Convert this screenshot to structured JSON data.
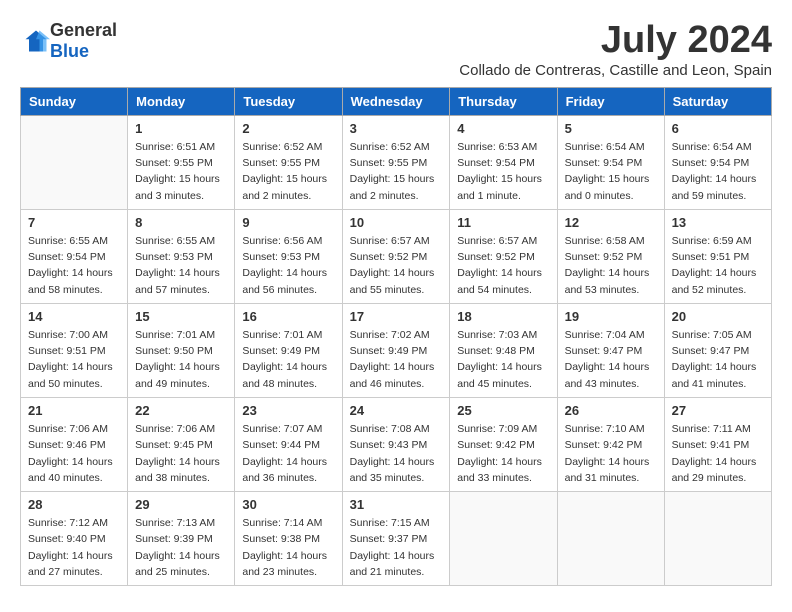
{
  "logo": {
    "general": "General",
    "blue": "Blue"
  },
  "title": {
    "month_year": "July 2024",
    "location": "Collado de Contreras, Castille and Leon, Spain"
  },
  "headers": [
    "Sunday",
    "Monday",
    "Tuesday",
    "Wednesday",
    "Thursday",
    "Friday",
    "Saturday"
  ],
  "weeks": [
    [
      {
        "day": "",
        "info": ""
      },
      {
        "day": "1",
        "info": "Sunrise: 6:51 AM\nSunset: 9:55 PM\nDaylight: 15 hours\nand 3 minutes."
      },
      {
        "day": "2",
        "info": "Sunrise: 6:52 AM\nSunset: 9:55 PM\nDaylight: 15 hours\nand 2 minutes."
      },
      {
        "day": "3",
        "info": "Sunrise: 6:52 AM\nSunset: 9:55 PM\nDaylight: 15 hours\nand 2 minutes."
      },
      {
        "day": "4",
        "info": "Sunrise: 6:53 AM\nSunset: 9:54 PM\nDaylight: 15 hours\nand 1 minute."
      },
      {
        "day": "5",
        "info": "Sunrise: 6:54 AM\nSunset: 9:54 PM\nDaylight: 15 hours\nand 0 minutes."
      },
      {
        "day": "6",
        "info": "Sunrise: 6:54 AM\nSunset: 9:54 PM\nDaylight: 14 hours\nand 59 minutes."
      }
    ],
    [
      {
        "day": "7",
        "info": "Sunrise: 6:55 AM\nSunset: 9:54 PM\nDaylight: 14 hours\nand 58 minutes."
      },
      {
        "day": "8",
        "info": "Sunrise: 6:55 AM\nSunset: 9:53 PM\nDaylight: 14 hours\nand 57 minutes."
      },
      {
        "day": "9",
        "info": "Sunrise: 6:56 AM\nSunset: 9:53 PM\nDaylight: 14 hours\nand 56 minutes."
      },
      {
        "day": "10",
        "info": "Sunrise: 6:57 AM\nSunset: 9:52 PM\nDaylight: 14 hours\nand 55 minutes."
      },
      {
        "day": "11",
        "info": "Sunrise: 6:57 AM\nSunset: 9:52 PM\nDaylight: 14 hours\nand 54 minutes."
      },
      {
        "day": "12",
        "info": "Sunrise: 6:58 AM\nSunset: 9:52 PM\nDaylight: 14 hours\nand 53 minutes."
      },
      {
        "day": "13",
        "info": "Sunrise: 6:59 AM\nSunset: 9:51 PM\nDaylight: 14 hours\nand 52 minutes."
      }
    ],
    [
      {
        "day": "14",
        "info": "Sunrise: 7:00 AM\nSunset: 9:51 PM\nDaylight: 14 hours\nand 50 minutes."
      },
      {
        "day": "15",
        "info": "Sunrise: 7:01 AM\nSunset: 9:50 PM\nDaylight: 14 hours\nand 49 minutes."
      },
      {
        "day": "16",
        "info": "Sunrise: 7:01 AM\nSunset: 9:49 PM\nDaylight: 14 hours\nand 48 minutes."
      },
      {
        "day": "17",
        "info": "Sunrise: 7:02 AM\nSunset: 9:49 PM\nDaylight: 14 hours\nand 46 minutes."
      },
      {
        "day": "18",
        "info": "Sunrise: 7:03 AM\nSunset: 9:48 PM\nDaylight: 14 hours\nand 45 minutes."
      },
      {
        "day": "19",
        "info": "Sunrise: 7:04 AM\nSunset: 9:47 PM\nDaylight: 14 hours\nand 43 minutes."
      },
      {
        "day": "20",
        "info": "Sunrise: 7:05 AM\nSunset: 9:47 PM\nDaylight: 14 hours\nand 41 minutes."
      }
    ],
    [
      {
        "day": "21",
        "info": "Sunrise: 7:06 AM\nSunset: 9:46 PM\nDaylight: 14 hours\nand 40 minutes."
      },
      {
        "day": "22",
        "info": "Sunrise: 7:06 AM\nSunset: 9:45 PM\nDaylight: 14 hours\nand 38 minutes."
      },
      {
        "day": "23",
        "info": "Sunrise: 7:07 AM\nSunset: 9:44 PM\nDaylight: 14 hours\nand 36 minutes."
      },
      {
        "day": "24",
        "info": "Sunrise: 7:08 AM\nSunset: 9:43 PM\nDaylight: 14 hours\nand 35 minutes."
      },
      {
        "day": "25",
        "info": "Sunrise: 7:09 AM\nSunset: 9:42 PM\nDaylight: 14 hours\nand 33 minutes."
      },
      {
        "day": "26",
        "info": "Sunrise: 7:10 AM\nSunset: 9:42 PM\nDaylight: 14 hours\nand 31 minutes."
      },
      {
        "day": "27",
        "info": "Sunrise: 7:11 AM\nSunset: 9:41 PM\nDaylight: 14 hours\nand 29 minutes."
      }
    ],
    [
      {
        "day": "28",
        "info": "Sunrise: 7:12 AM\nSunset: 9:40 PM\nDaylight: 14 hours\nand 27 minutes."
      },
      {
        "day": "29",
        "info": "Sunrise: 7:13 AM\nSunset: 9:39 PM\nDaylight: 14 hours\nand 25 minutes."
      },
      {
        "day": "30",
        "info": "Sunrise: 7:14 AM\nSunset: 9:38 PM\nDaylight: 14 hours\nand 23 minutes."
      },
      {
        "day": "31",
        "info": "Sunrise: 7:15 AM\nSunset: 9:37 PM\nDaylight: 14 hours\nand 21 minutes."
      },
      {
        "day": "",
        "info": ""
      },
      {
        "day": "",
        "info": ""
      },
      {
        "day": "",
        "info": ""
      }
    ]
  ]
}
